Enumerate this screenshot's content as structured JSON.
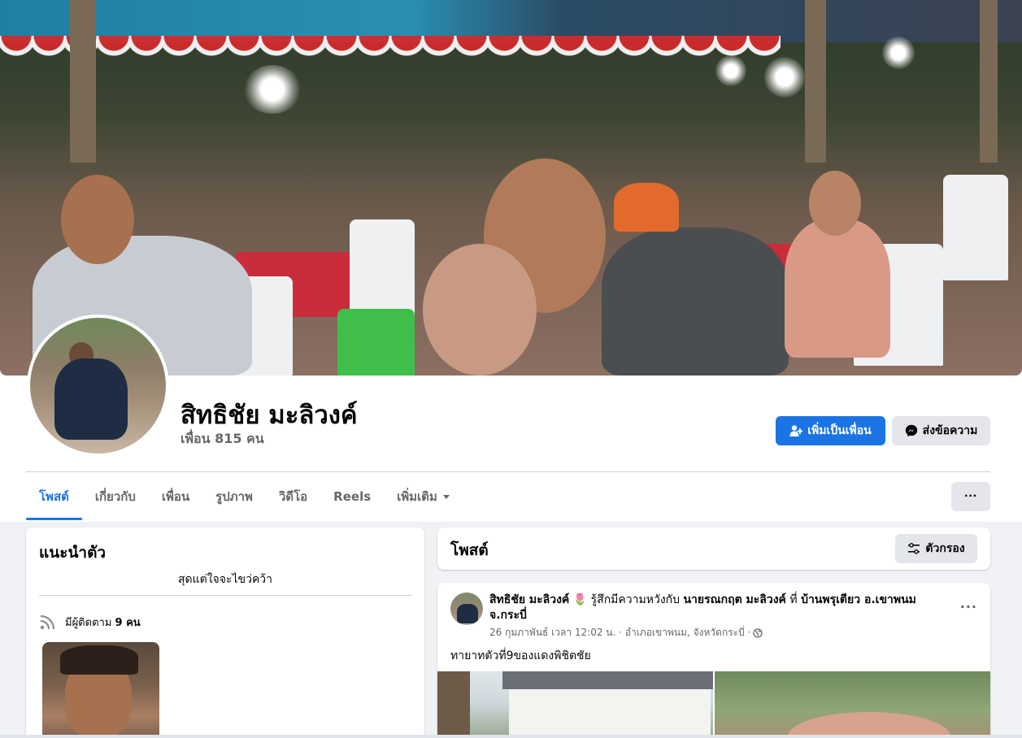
{
  "profile": {
    "name": "สิทธิชัย มะลิวงค์",
    "friends_text": "เพื่อน 815 คน"
  },
  "actions": {
    "add_friend_label": "เพิ่มเป็นเพื่อน",
    "message_label": "ส่งข้อความ",
    "more_label": "···"
  },
  "tabs": [
    {
      "label": "โพสต์",
      "active": true
    },
    {
      "label": "เกี่ยวกับ"
    },
    {
      "label": "เพื่อน"
    },
    {
      "label": "รูปภาพ"
    },
    {
      "label": "วิดีโอ"
    },
    {
      "label": "Reels"
    },
    {
      "label": "เพิ่มเติม"
    }
  ],
  "intro": {
    "title": "แนะนำตัว",
    "bio": "สุดแต่ใจจะไขว่คว้า",
    "followers_prefix": "มีผู้ติดตาม ",
    "followers_count": "9 คน"
  },
  "posts": {
    "title": "โพสต์",
    "filter_label": "ตัวกรอง"
  },
  "post": {
    "author": "สิทธิชัย มะลิวงค์",
    "emoji": "🌷",
    "feeling": " รู้สึกมีความหวังกับ ",
    "tagged": "นายรณกฤต มะลิวงค์",
    "at": " ที่ ",
    "place": "บ้านพรุเตียว อ.เขาพนม จ.กระบี่",
    "meta": "26 กุมภาพันธ์ เวลา 12:02 น. · อำเภอเขาพนม, จังหวัดกระบี่ ·",
    "text": "ทายาทตัวที่9ของแดงพิชิตชัย",
    "more": "···"
  },
  "colors": {
    "accent": "#1b74e4",
    "secondary_button": "#e4e6eb",
    "page_bg": "#f0f2f5",
    "muted_text": "#65676b"
  }
}
